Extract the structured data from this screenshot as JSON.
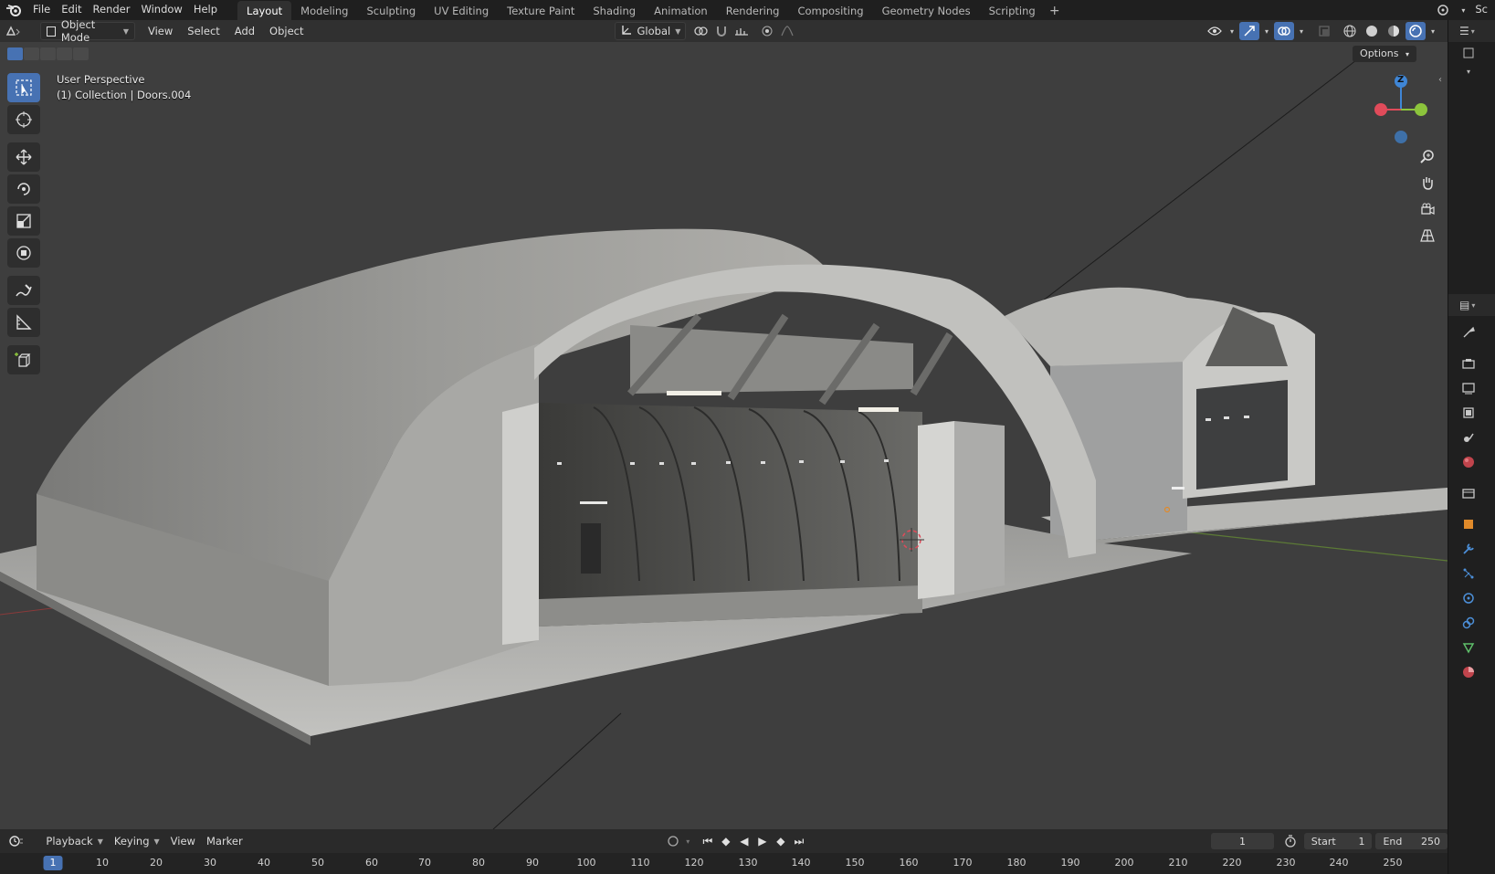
{
  "app": {
    "logo_icon": "blender-logo-icon",
    "menu": [
      "File",
      "Edit",
      "Render",
      "Window",
      "Help"
    ],
    "workspaces": [
      "Layout",
      "Modeling",
      "Sculpting",
      "UV Editing",
      "Texture Paint",
      "Shading",
      "Animation",
      "Rendering",
      "Compositing",
      "Geometry Nodes",
      "Scripting"
    ],
    "active_workspace": "Layout",
    "add_workspace": "+",
    "scene_label": "Sc"
  },
  "viewport_header": {
    "mode": "Object Mode",
    "menus": [
      "View",
      "Select",
      "Add",
      "Object"
    ],
    "orientation": "Global",
    "options": "Options"
  },
  "viewport": {
    "perspective": "User Perspective",
    "collection": "(1) Collection | Doors.004",
    "background_color": "#3e3e3e",
    "gizmo": {
      "z_label": "Z",
      "x_color": "#e04b5a",
      "y_color": "#8cc43c",
      "z_color": "#3f86d6"
    }
  },
  "timeline": {
    "menus": [
      "Playback",
      "Keying",
      "View",
      "Marker"
    ],
    "current_frame": "1",
    "start_label": "Start",
    "start_value": "1",
    "end_label": "End",
    "end_value": "250",
    "ruler_current": "1",
    "ruler_ticks": [
      "10",
      "20",
      "30",
      "40",
      "50",
      "60",
      "70",
      "80",
      "90",
      "100",
      "110",
      "120",
      "130",
      "140",
      "150",
      "160",
      "170",
      "180",
      "190",
      "200",
      "210",
      "220",
      "230",
      "240",
      "250"
    ]
  },
  "colors": {
    "accent": "#4772b3",
    "x_axis": "#e04b5a",
    "y_axis": "#8cc43c",
    "z_axis": "#3f86d6"
  }
}
